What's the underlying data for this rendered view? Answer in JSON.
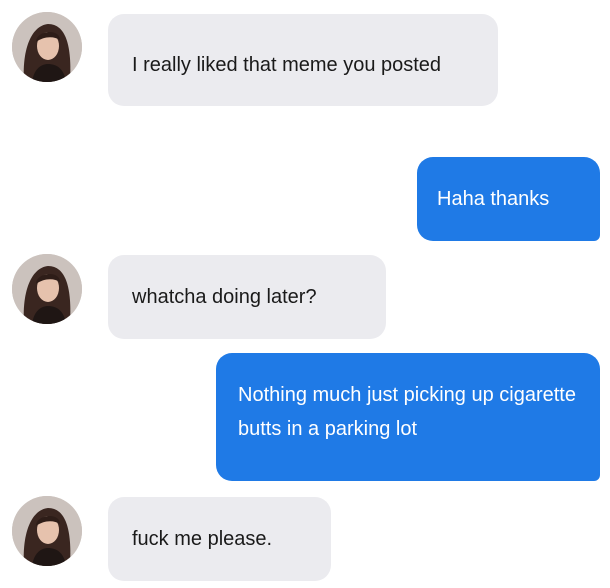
{
  "conversation": {
    "messages": [
      {
        "sender": "contact",
        "text": "I really liked that meme you posted"
      },
      {
        "sender": "me",
        "text": "Haha thanks"
      },
      {
        "sender": "contact",
        "text": "whatcha doing later?"
      },
      {
        "sender": "me",
        "text": "Nothing much just picking up cigarette butts in a parking lot"
      },
      {
        "sender": "contact",
        "text": "fuck me please."
      }
    ]
  },
  "colors": {
    "incoming_bubble": "#ebebef",
    "outgoing_bubble": "#1f7ae6",
    "incoming_text": "#1a1a1a",
    "outgoing_text": "#ffffff"
  },
  "icons": {
    "contact_avatar": "contact-avatar-photo"
  }
}
